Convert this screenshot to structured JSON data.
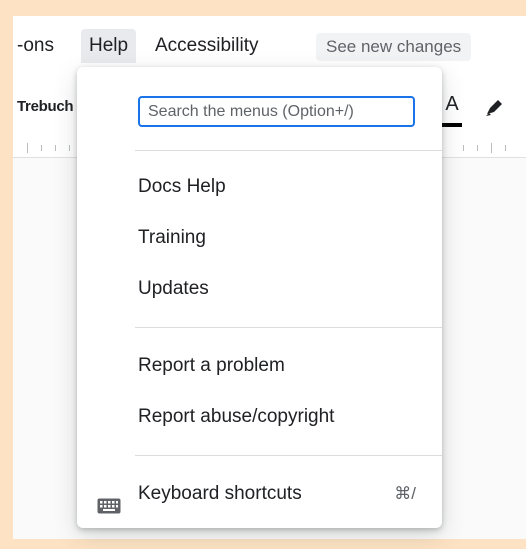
{
  "menubar": {
    "addons_label": "-ons",
    "help_label": "Help",
    "accessibility_label": "Accessibility",
    "see_changes_label": "See new changes"
  },
  "toolbar": {
    "font_name": "Trebuch",
    "text_color_glyph": "A",
    "text_color_icon": "text-color-icon",
    "highlight_icon": "highlighter-pen-icon"
  },
  "help_menu": {
    "search_placeholder": "Search the menus (Option+/)",
    "items": [
      {
        "label": "Docs Help"
      },
      {
        "label": "Training"
      },
      {
        "label": "Updates"
      },
      {
        "label": "Report a problem"
      },
      {
        "label": "Report abuse/copyright"
      },
      {
        "label": "Keyboard shortcuts",
        "shortcut": "⌘/",
        "icon": "keyboard-icon"
      }
    ]
  },
  "colors": {
    "frame": "#fde3c3",
    "accent": "#1a73e8",
    "menu_text": "#202124",
    "active_menu_bg": "#e8eaed"
  }
}
